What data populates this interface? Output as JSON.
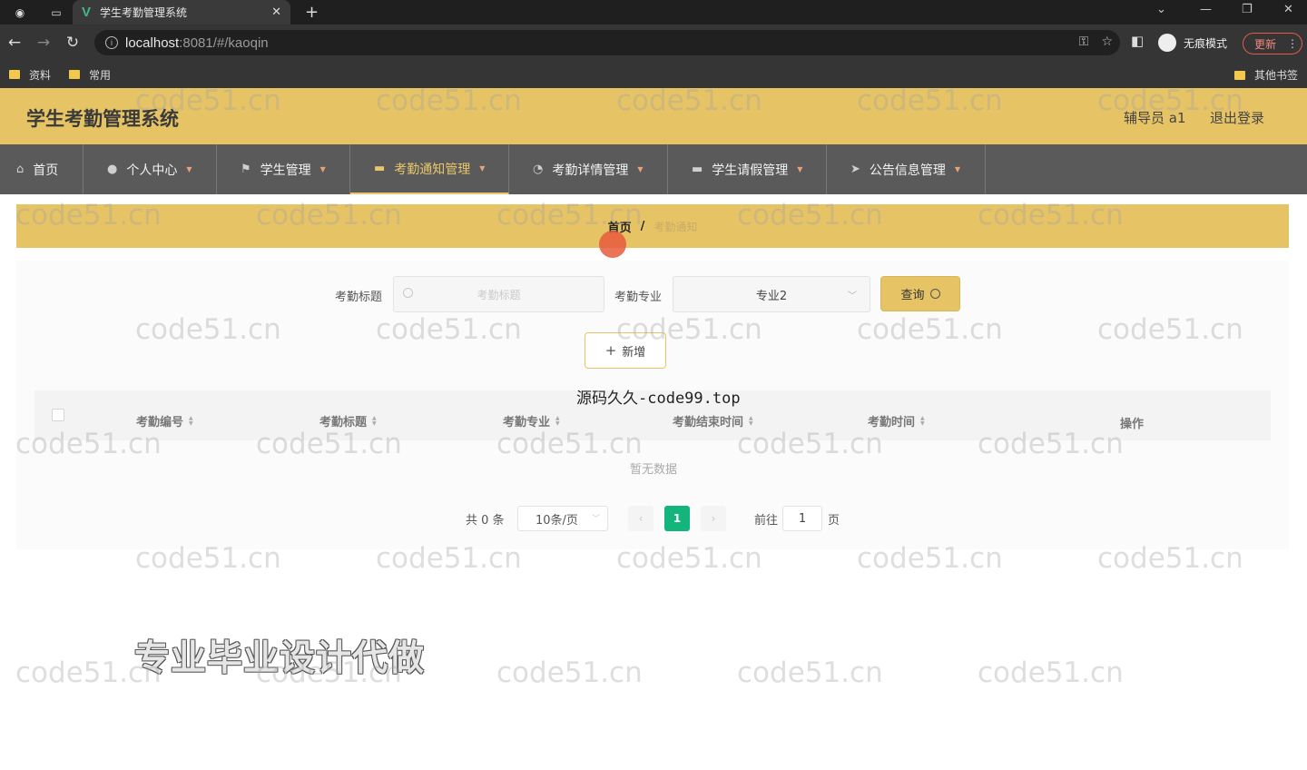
{
  "browser": {
    "tab_title": "学生考勤管理系统",
    "url_host": "localhost",
    "url_rest": ":8081/#/kaoqin",
    "incognito_label": "无痕模式",
    "update_label": "更新",
    "bookmarks": [
      "资料",
      "常用"
    ],
    "other_bookmarks": "其他书签"
  },
  "header": {
    "title": "学生考勤管理系统",
    "user": "辅导员 a1",
    "logout": "退出登录"
  },
  "menu": {
    "items": [
      {
        "label": "首页",
        "icon": "home-icon"
      },
      {
        "label": "个人中心",
        "icon": "user-icon"
      },
      {
        "label": "学生管理",
        "icon": "flag-icon"
      },
      {
        "label": "考勤通知管理",
        "icon": "monitor-icon",
        "active": true
      },
      {
        "label": "考勤详情管理",
        "icon": "compass-icon"
      },
      {
        "label": "学生请假管理",
        "icon": "monitor-icon"
      },
      {
        "label": "公告信息管理",
        "icon": "send-icon"
      }
    ]
  },
  "breadcrumb": {
    "home": "首页",
    "separator": "/",
    "current": "考勤通知"
  },
  "search": {
    "title_label": "考勤标题",
    "title_placeholder": "考勤标题",
    "major_label": "考勤专业",
    "major_value": "专业2",
    "query_button": "查询",
    "add_button": "新增"
  },
  "table": {
    "columns": [
      "考勤编号",
      "考勤标题",
      "考勤专业",
      "考勤结束时间",
      "考勤时间",
      "操作"
    ],
    "empty_text": "暂无数据"
  },
  "pagination": {
    "total": "共 0 条",
    "page_size": "10条/页",
    "current_page": "1",
    "goto_label": "前往",
    "goto_value": "1",
    "goto_suffix": "页"
  },
  "overlays": {
    "code99": "源码久久-code99.top",
    "promo": "专业毕业设计代做",
    "watermark": "code51.cn"
  }
}
